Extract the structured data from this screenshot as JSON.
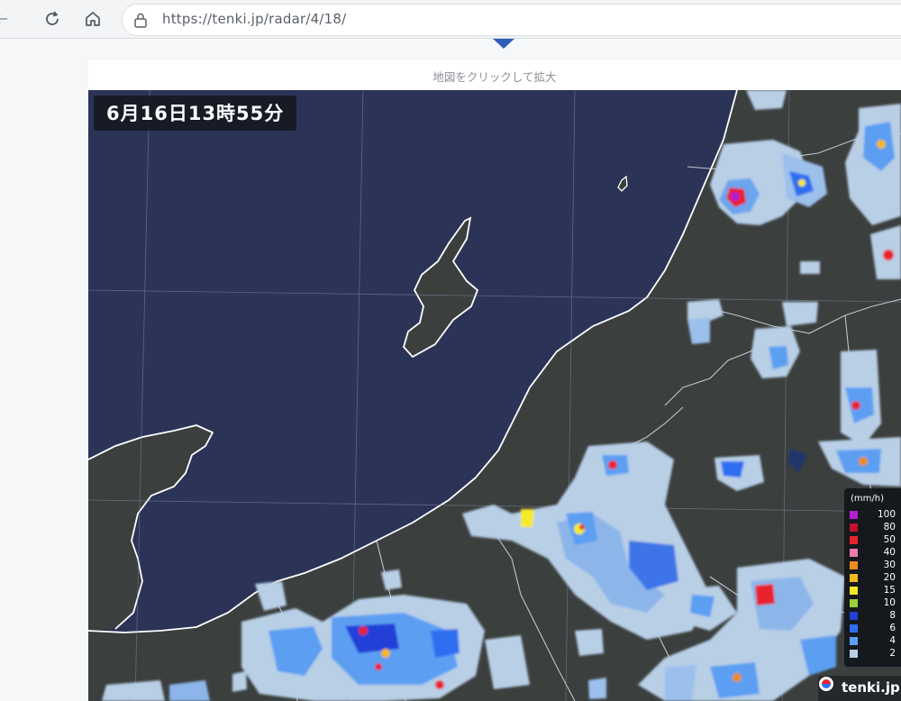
{
  "browser": {
    "url": "https://tenki.jp/radar/4/18/",
    "back_icon": "back-arrow-icon",
    "reload_icon": "reload-icon",
    "home_icon": "home-icon",
    "lock_icon": "lock-icon"
  },
  "page": {
    "caption": "地図をクリックして拡大",
    "timestamp": "6月16日13時55分",
    "brand": "tenki.jp"
  },
  "legend": {
    "title": "(mm/h)",
    "items": [
      {
        "label": "100",
        "color": "#b01fd0"
      },
      {
        "label": "80",
        "color": "#c4102a"
      },
      {
        "label": "50",
        "color": "#e8232f"
      },
      {
        "label": "40",
        "color": "#f07ab0"
      },
      {
        "label": "30",
        "color": "#ef8a1f"
      },
      {
        "label": "20",
        "color": "#f2b81d"
      },
      {
        "label": "15",
        "color": "#f5ea2a"
      },
      {
        "label": "10",
        "color": "#9ad13a"
      },
      {
        "label": "8",
        "color": "#2240d8"
      },
      {
        "label": "6",
        "color": "#2d6ef0"
      },
      {
        "label": "4",
        "color": "#5b9ff2"
      },
      {
        "label": "2",
        "color": "#b8cfe6"
      }
    ]
  }
}
